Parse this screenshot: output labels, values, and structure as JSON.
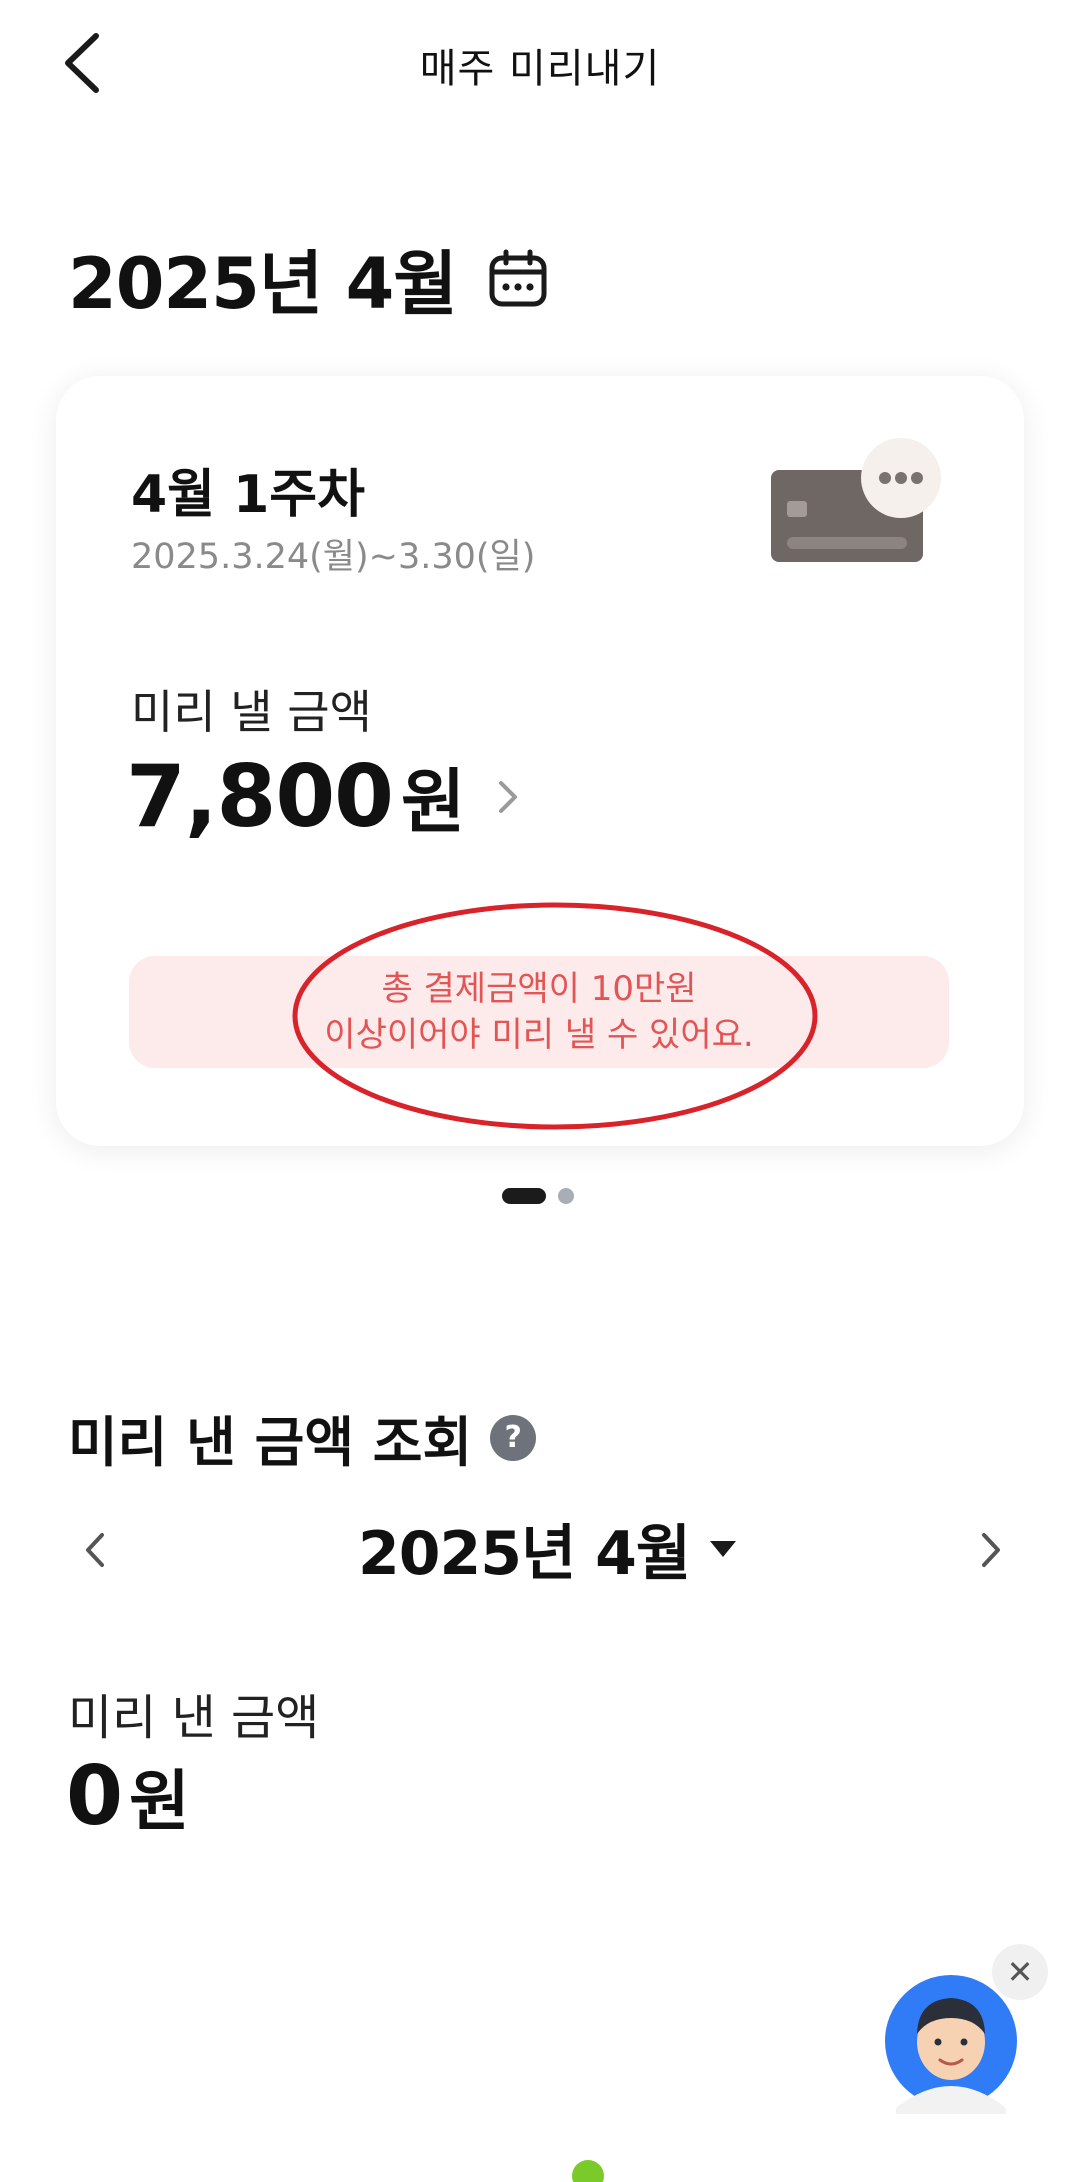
{
  "header": {
    "title": "매주 미리내기"
  },
  "month_heading": "2025년 4월",
  "week_card": {
    "title": "4월 1주차",
    "date_range": "2025.3.24(월)~3.30(일)",
    "amount_label": "미리 낼 금액",
    "amount_value": "7,800",
    "amount_unit": "원",
    "notice_line1": "총 결제금액이 10만원",
    "notice_line2": "이상이어야 미리 낼 수 있어요.",
    "notice_color": "#e25555",
    "notice_bg": "#fdeaea",
    "annotation_color": "#d8232a"
  },
  "pager": {
    "pages": 2,
    "current": 1
  },
  "history": {
    "title": "미리 낸 금액 조회",
    "help_glyph": "?",
    "month_label": "2025년 4월",
    "paid_label": "미리 낸 금액",
    "paid_value": "0",
    "paid_unit": "원"
  },
  "chatbot": {
    "close_glyph": "✕",
    "accent": "#2f7cf6"
  },
  "icons": {
    "back": "chevron-left-icon",
    "calendar": "calendar-icon",
    "card": "credit-card-icon",
    "more": "more-dots-icon",
    "chevron_right": "chevron-right-icon",
    "help": "help-icon",
    "caret_down": "caret-down-icon",
    "close": "close-icon"
  }
}
